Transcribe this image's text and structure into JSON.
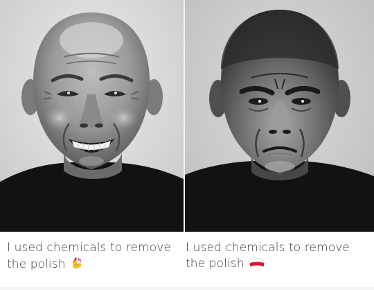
{
  "panels": [
    {
      "caption_line1": "I used chemicals to remove",
      "caption_line2": "the polish",
      "emoji": "nail-polish-emoji",
      "mood": "smiling"
    },
    {
      "caption_line1": "I used chemicals to remove",
      "caption_line2": "the polish",
      "emoji": "poland-flag-emoji",
      "mood": "frowning"
    }
  ],
  "colors": {
    "left_background": "#dedddd",
    "right_background": "#cfcfcf",
    "sweater": "#121212",
    "caption_text": "#3c3c3c",
    "polish_yellow": "#f2c12e",
    "polish_pink": "#c2185b",
    "flag_white": "#ffffff",
    "flag_red": "#dc143c"
  }
}
